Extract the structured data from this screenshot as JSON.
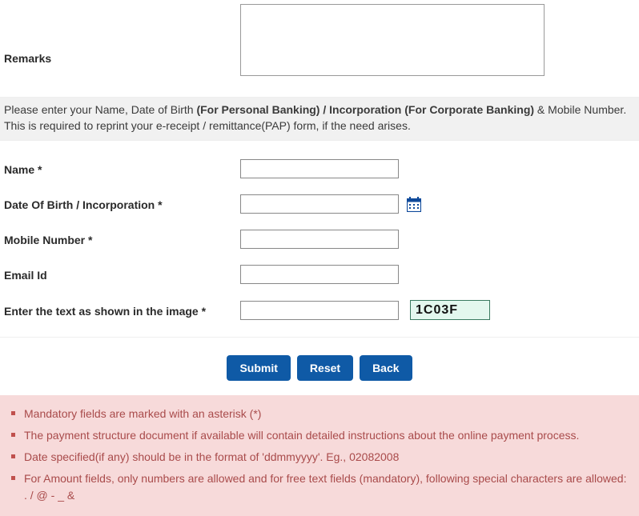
{
  "form": {
    "remarks": {
      "label": "Remarks",
      "value": ""
    },
    "instruction": {
      "prefix": "Please enter your Name, Date of Birth ",
      "bold": "(For Personal Banking) / Incorporation (For Corporate Banking)",
      "suffix": "  & Mobile Number.",
      "line2": "This is required to reprint your e-receipt / remittance(PAP) form, if the need arises."
    },
    "name": {
      "label": "Name *",
      "value": ""
    },
    "dob": {
      "label": "Date Of Birth / Incorporation *",
      "value": ""
    },
    "mobile": {
      "label": "Mobile Number *",
      "value": ""
    },
    "email": {
      "label": "Email Id",
      "value": ""
    },
    "captcha": {
      "label": "Enter the text as shown in the image *",
      "value": "",
      "image_text": "1C03F"
    }
  },
  "buttons": {
    "submit": "Submit",
    "reset": "Reset",
    "back": "Back"
  },
  "notes": [
    "Mandatory fields are marked with an asterisk (*)",
    "The payment structure document if available will contain detailed instructions about the online payment process.",
    "Date specified(if any) should be in the format of 'ddmmyyyy'. Eg., 02082008",
    "For Amount fields, only numbers are allowed and for free text fields (mandatory), following special characters are allowed: . / @ - _ &"
  ]
}
